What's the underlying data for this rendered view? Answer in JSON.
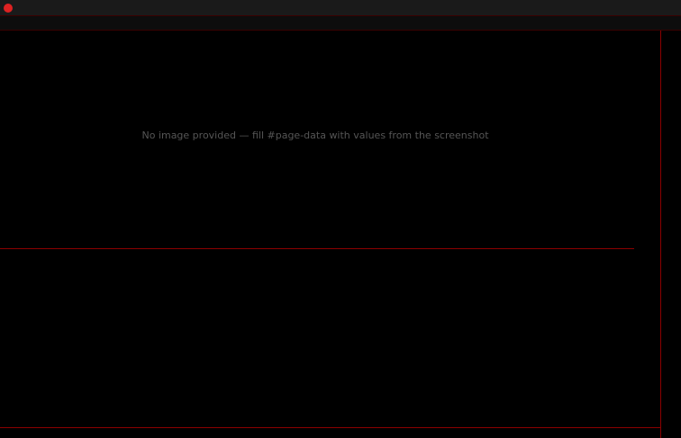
{
  "menubar": {
    "app_title": "",
    "items": [
      {
        "label": ""
      },
      {
        "label": ""
      },
      {
        "label": ""
      },
      {
        "label": ""
      },
      {
        "label": ""
      },
      {
        "label": ""
      }
    ],
    "notice": "",
    "right_buttons": [
      {
        "label": ""
      },
      {
        "label": ""
      },
      {
        "label": ""
      },
      {
        "label": ""
      }
    ]
  },
  "toolbar": {
    "period_tabs": [
      {
        "label": ""
      },
      {
        "label": ""
      },
      {
        "label": ""
      },
      {
        "label": ""
      },
      {
        "label": ""
      },
      {
        "label": ""
      },
      {
        "label": ""
      },
      {
        "label": ""
      }
    ],
    "active_tab": 0,
    "tools": [
      {
        "label": ""
      },
      {
        "label": ""
      },
      {
        "label": ""
      },
      {
        "label": ""
      },
      {
        "label": ""
      }
    ]
  },
  "price_pane": {
    "title": "",
    "ma_legend": [
      {
        "label": "",
        "color": "#ffffff"
      },
      {
        "label": "",
        "color": "#ffff00"
      },
      {
        "label": "",
        "color": "#ff00ff"
      },
      {
        "label": "",
        "color": "#00ff00"
      }
    ],
    "empty_note": "No image provided — fill #page-data with values from the screenshot"
  },
  "indicator_pane": {
    "title": "",
    "legend": [
      {
        "label": "",
        "color": "#ffffff"
      },
      {
        "label": "",
        "color": "#ff00ff"
      },
      {
        "label": "",
        "color": "#00ff00"
      }
    ]
  },
  "quote_panel": {
    "rows": [
      {
        "label": ""
      },
      {
        "label": ""
      },
      {
        "label": ""
      },
      {
        "label": ""
      },
      {
        "label": ""
      },
      {
        "label": ""
      }
    ]
  },
  "colors": {
    "up": "#ff3030",
    "down": "#00ffff",
    "grid": "#8b0000"
  },
  "chart_data": [
    {
      "type": "line",
      "title": "",
      "x": [],
      "series": [],
      "ylim": [
        0,
        1
      ],
      "y_ticks": []
    },
    {
      "type": "line",
      "title": "",
      "x": [],
      "series": [],
      "ylim": [
        -1,
        1
      ],
      "y_ticks": []
    }
  ]
}
